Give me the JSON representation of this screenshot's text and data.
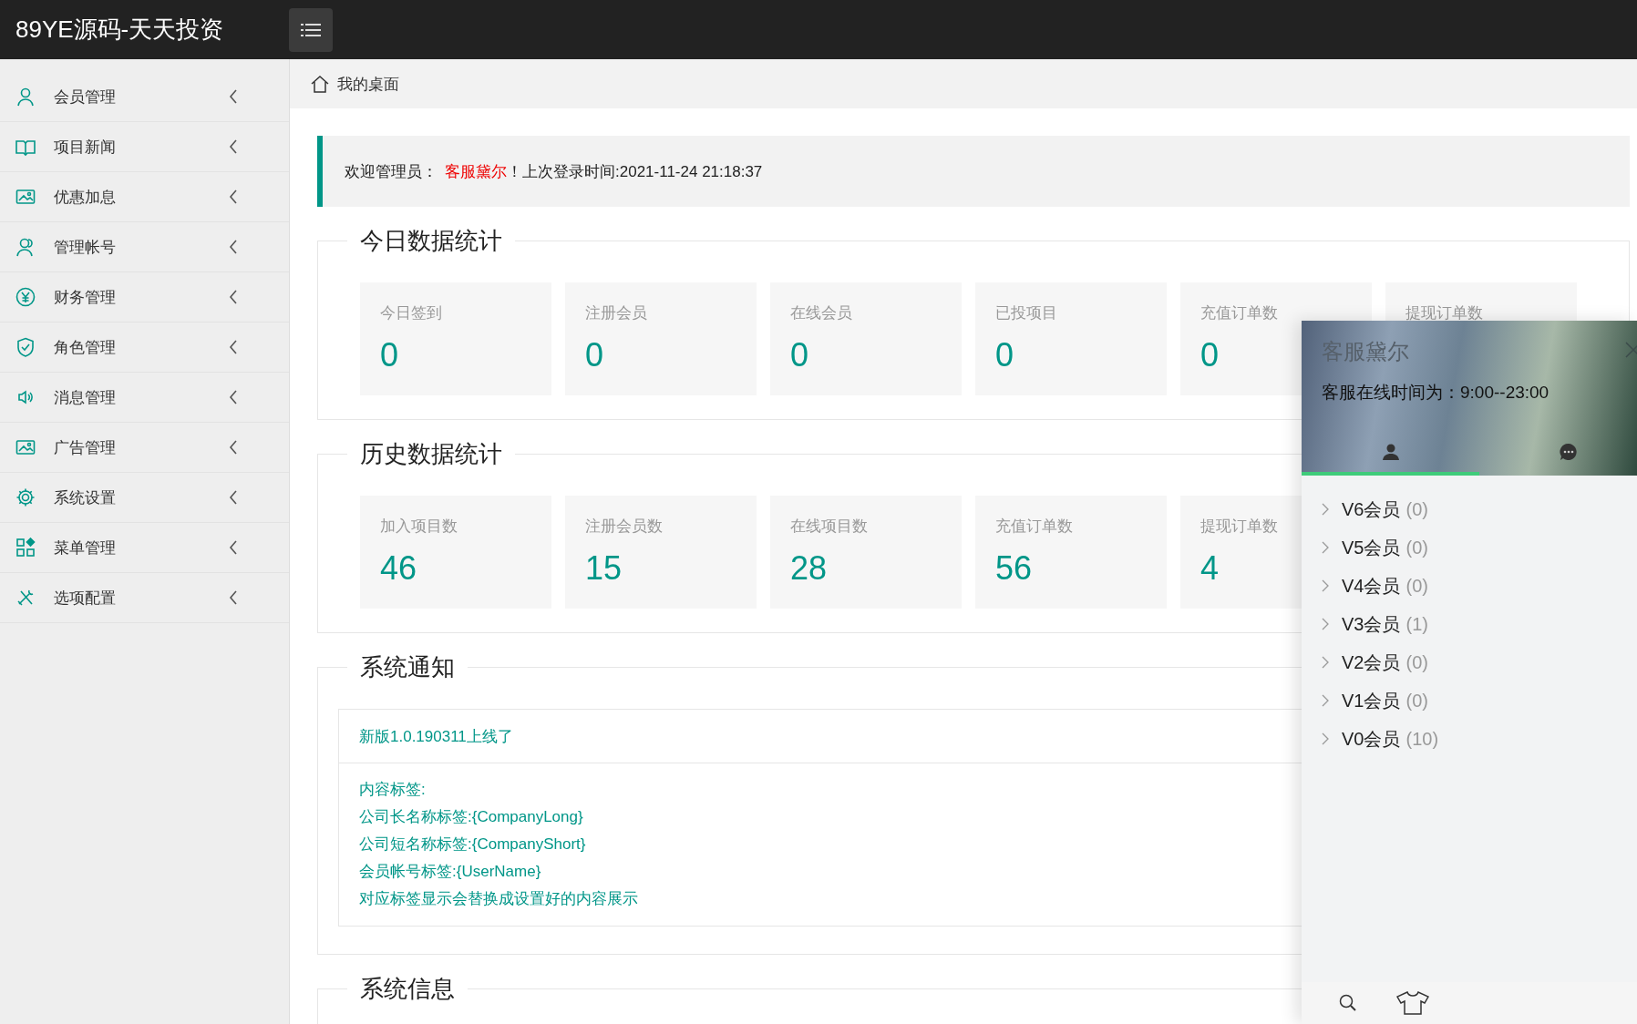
{
  "header": {
    "logo": "89YE源码-天天投资"
  },
  "sidebar": {
    "items": [
      {
        "label": "会员管理"
      },
      {
        "label": "项目新闻"
      },
      {
        "label": "优惠加息"
      },
      {
        "label": "管理帐号"
      },
      {
        "label": "财务管理"
      },
      {
        "label": "角色管理"
      },
      {
        "label": "消息管理"
      },
      {
        "label": "广告管理"
      },
      {
        "label": "系统设置"
      },
      {
        "label": "菜单管理"
      },
      {
        "label": "选项配置"
      }
    ]
  },
  "breadcrumb": {
    "label": "我的桌面"
  },
  "welcome": {
    "prefix": "欢迎管理员：",
    "name": "客服黛尔",
    "suffix": "！上次登录时间:2021-11-24 21:18:37"
  },
  "sections": [
    {
      "title": "今日数据统计",
      "cards": [
        {
          "label": "今日签到",
          "value": "0"
        },
        {
          "label": "注册会员",
          "value": "0"
        },
        {
          "label": "在线会员",
          "value": "0"
        },
        {
          "label": "已投项目",
          "value": "0"
        },
        {
          "label": "充值订单数",
          "value": "0"
        },
        {
          "label": "提现订单数"
        }
      ]
    },
    {
      "title": "历史数据统计",
      "cards": [
        {
          "label": "加入项目数",
          "value": "46"
        },
        {
          "label": "注册会员数",
          "value": "15"
        },
        {
          "label": "在线项目数",
          "value": "28"
        },
        {
          "label": "充值订单数",
          "value": "56"
        },
        {
          "label": "提现订单数",
          "value": "4"
        }
      ]
    }
  ],
  "notice": {
    "title": "系统通知",
    "headline": "新版1.0.190311上线了",
    "lines": [
      "内容标签:",
      "公司长名称标签:{CompanyLong}",
      "公司短名称标签:{CompanyShort}",
      "会员帐号标签:{UserName}",
      "对应标签显示会替换成设置好的内容展示"
    ]
  },
  "system_info": {
    "title": "系统信息"
  },
  "chat_panel": {
    "title": "客服黛尔",
    "hours": "客服在线时间为：9:00--23:00",
    "tabs": [
      {
        "selected": true
      },
      {
        "selected": false
      }
    ],
    "groups": [
      {
        "name": "V6会员",
        "count": "(0)"
      },
      {
        "name": "V5会员",
        "count": "(0)"
      },
      {
        "name": "V4会员",
        "count": "(0)"
      },
      {
        "name": "V3会员",
        "count": "(1)"
      },
      {
        "name": "V2会员",
        "count": "(0)"
      },
      {
        "name": "V1会员",
        "count": "(0)"
      },
      {
        "name": "V0会员",
        "count": "(10)"
      }
    ]
  }
}
